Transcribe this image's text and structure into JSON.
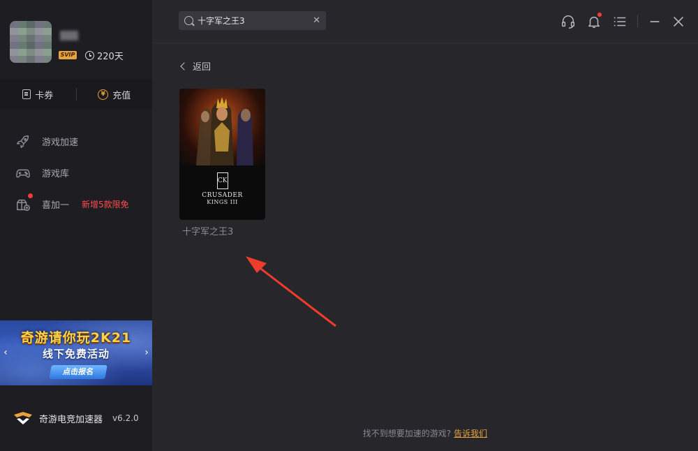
{
  "profile": {
    "vip_badge": "SVIP",
    "vip_days": "220天"
  },
  "quick_actions": {
    "coupon_label": "卡券",
    "recharge_label": "充值"
  },
  "nav": {
    "items": [
      {
        "label": "游戏加速",
        "icon": "rocket-icon"
      },
      {
        "label": "游戏库",
        "icon": "gamepad-icon"
      },
      {
        "label": "喜加一",
        "icon": "gift-plus-icon",
        "promo": "新增5款限免"
      }
    ]
  },
  "banner": {
    "title": "奇游请你玩2K21",
    "subtitle": "线下免费活动",
    "button": "点击报名"
  },
  "brand": {
    "name": "奇游电竞加速器",
    "version": "v6.2.0"
  },
  "search": {
    "value": "十字军之王3"
  },
  "back_label": "返回",
  "game": {
    "title": "十字军之王3",
    "cover_line1": "CRUSADER",
    "cover_line2": "KINGS III",
    "cover_crest": "CK"
  },
  "footer": {
    "hint": "找不到想要加速的游戏?",
    "link": "告诉我们"
  },
  "colors": {
    "accent": "#e8a33c",
    "alert": "#ff3b3b",
    "arrow": "#f03c2a"
  }
}
